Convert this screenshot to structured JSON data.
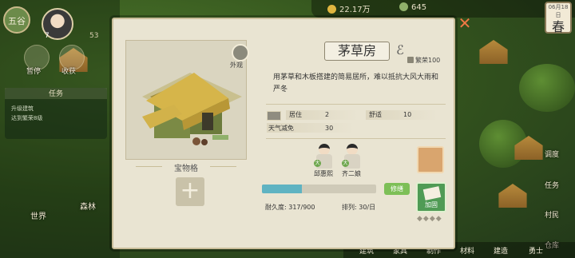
{
  "hud": {
    "emblem": "五谷",
    "level": "7",
    "count": "53",
    "coins": "22.17万",
    "resource2": "645",
    "day": "06月18日",
    "season": "春"
  },
  "left": {
    "items": [
      "暂停",
      "收获"
    ],
    "task_title": "任务",
    "tasks": [
      "升级建筑",
      "达到繁荣8级"
    ],
    "world": "世界",
    "forest": "森林",
    "forest_btn_label": "森林"
  },
  "right": {
    "items": [
      "调度",
      "任务",
      "村民",
      "仓库"
    ]
  },
  "bottom": {
    "items": [
      "建筑",
      "家具",
      "制作",
      "材料",
      "建造",
      "勇士"
    ]
  },
  "dialog": {
    "view_label": "外观",
    "treasure_label": "宝物格",
    "add_symbol": "+",
    "title": "茅草房",
    "prosperity": "繁荣100",
    "description": "用茅草和木板搭建的简易居所，难以抵抗大风大雨和严冬",
    "stats": {
      "live_label": "居住",
      "live_value": "2",
      "comfort_label": "舒适",
      "comfort_value": "10",
      "weather_label": "天气减免",
      "weather_value": "30"
    },
    "workers": [
      {
        "name": "邱惠熙",
        "badge": "大"
      },
      {
        "name": "齐二娘",
        "badge": "大"
      }
    ],
    "durability_text": "耐久度: 317/900",
    "durability_fraction": 0.352,
    "repair_label": "修缮",
    "order_text": "排列: 30/日",
    "upgrade_label": "加固",
    "dots": "◆◆◆◆",
    "close_symbol": "✕"
  }
}
